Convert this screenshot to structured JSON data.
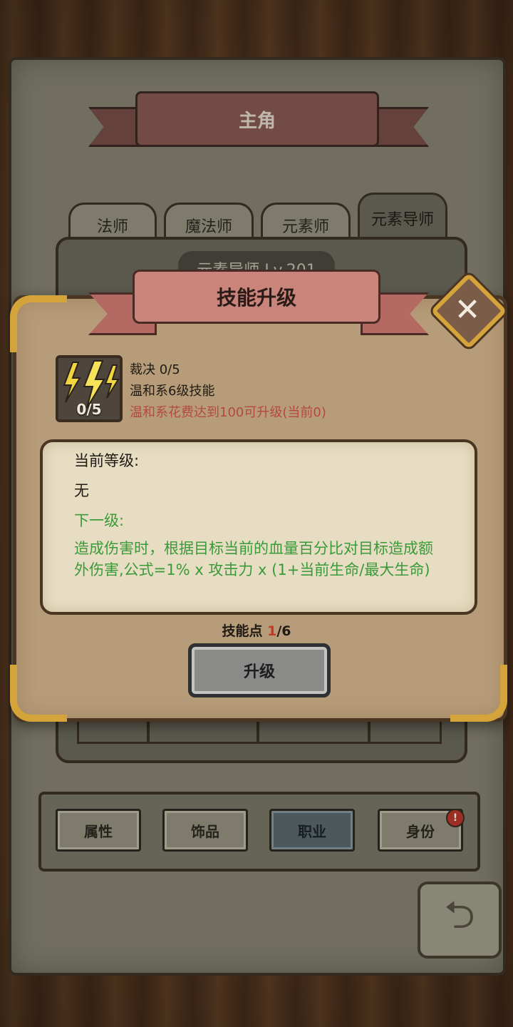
{
  "background": {
    "title": "主角",
    "tabs": [
      {
        "label": "法师",
        "active": false
      },
      {
        "label": "魔法师",
        "active": false
      },
      {
        "label": "元素师",
        "active": false
      },
      {
        "label": "元素导师",
        "active": true
      }
    ],
    "level_text": "元素导师 Lv.201",
    "bottom_nav": [
      {
        "label": "属性",
        "active": false
      },
      {
        "label": "饰品",
        "active": false
      },
      {
        "label": "职业",
        "active": true
      },
      {
        "label": "身份",
        "active": false,
        "alert": "!"
      }
    ]
  },
  "dialog": {
    "title": "技能升级",
    "close_icon": "close-icon",
    "skill": {
      "icon": "lightning-icon",
      "count": "0/5",
      "name": "裁决 0/5",
      "type": "温和系6级技能",
      "requirement": "温和系花费达到100可升级(当前0)"
    },
    "current_label": "当前等级:",
    "current_value": "无",
    "next_label": "下一级:",
    "next_value": "造成伤害时，根据目标当前的血量百分比对目标造成额外伤害,公式=1% x 攻击力 x (1+当前生命/最大生命)",
    "points_label": "技能点 ",
    "points_current": "1",
    "points_total": "/6",
    "upgrade_button": "升级"
  },
  "colors": {
    "requirement_text": "#b34a3c",
    "next_level_text": "#3a9a3a",
    "accent_gold": "#d4a43a"
  }
}
